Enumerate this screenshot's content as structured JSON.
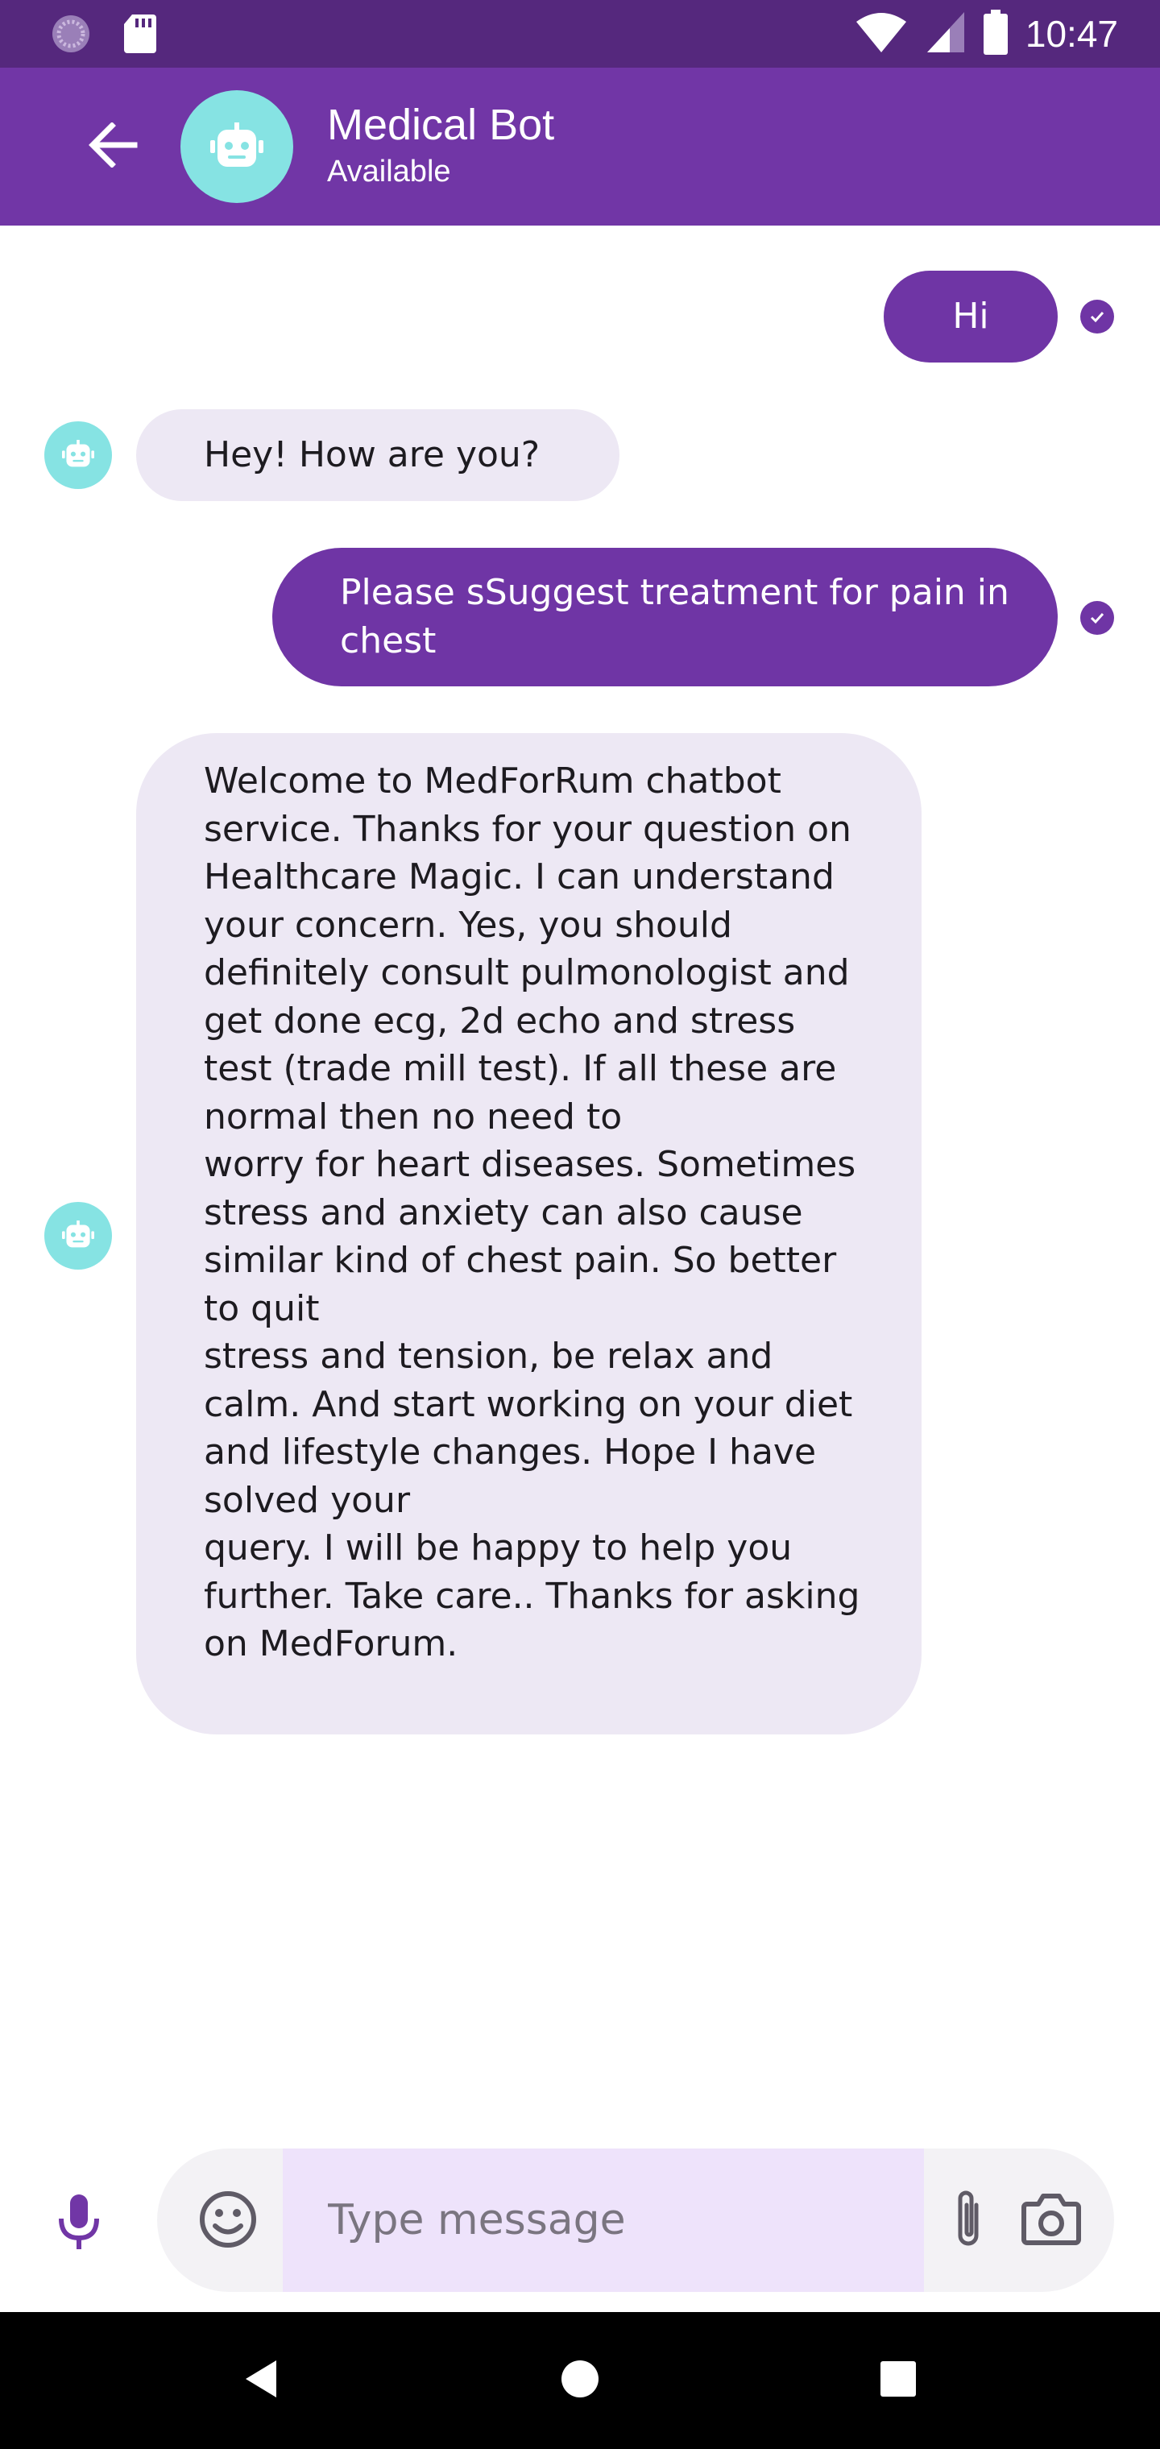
{
  "status_bar": {
    "time": "10:47"
  },
  "header": {
    "title": "Medical Bot",
    "subtitle": "Available"
  },
  "messages": [
    {
      "sender": "user",
      "text": "Hi"
    },
    {
      "sender": "bot",
      "text": "Hey! How are you?"
    },
    {
      "sender": "user",
      "text": "Please sSuggest treatment for pain in chest"
    },
    {
      "sender": "bot",
      "text": "Welcome to MedForRum chatbot service. Thanks for your question on  Healthcare  Magic. I can understand your concern.  Yes, you should definitely consult pulmonologist and get done ecg, 2d echo and stress test (trade mill test).  If all these are normal then no need to\nworry for heart diseases. Sometimes stress and anxiety can also cause similar kind of chest pain. So better to quit\nstress and tension, be relax and calm. And start working on your diet and lifestyle changes. Hope  I have solved your\nquery. I will be happy to help you further. Take care.. Thanks for asking on MedForum."
    }
  ],
  "composer": {
    "placeholder": "Type message",
    "value": ""
  },
  "colors": {
    "status_bar": "#55287d",
    "app_bar": "#7136a6",
    "outgoing_bubble": "#6f35a5",
    "incoming_bubble": "#ede8f4",
    "bot_avatar": "#86e3e3",
    "input_field": "#eee3fb"
  },
  "icons": {
    "status_left": [
      "app-notification-icon",
      "sd-card-icon"
    ],
    "status_right": [
      "wifi-icon",
      "cellular-signal-icon",
      "battery-icon"
    ],
    "header": [
      "back-arrow-icon",
      "robot-icon"
    ],
    "message_status": "delivered-check-icon",
    "composer": [
      "microphone-icon",
      "emoji-icon",
      "paperclip-icon",
      "camera-icon"
    ],
    "navigation": [
      "nav-back-icon",
      "nav-home-icon",
      "nav-recents-icon"
    ]
  }
}
